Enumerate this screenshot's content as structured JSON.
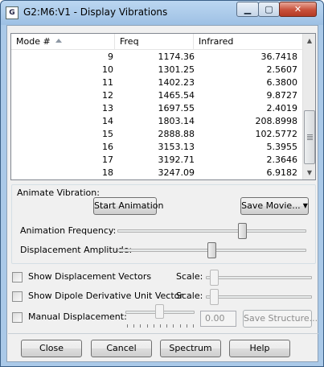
{
  "window": {
    "app_icon_text": "G",
    "title": "G2:M6:V1 - Display Vibrations",
    "min_glyph": "▁",
    "max_glyph": "▢",
    "close_glyph": "✕"
  },
  "table": {
    "headers": {
      "mode": "Mode #",
      "freq": "Freq",
      "ir": "Infrared"
    },
    "rows": [
      {
        "mode": "9",
        "freq": "1174.36",
        "ir": "36.7418"
      },
      {
        "mode": "10",
        "freq": "1301.25",
        "ir": "2.5607"
      },
      {
        "mode": "11",
        "freq": "1402.23",
        "ir": "6.3800"
      },
      {
        "mode": "12",
        "freq": "1465.54",
        "ir": "9.8727"
      },
      {
        "mode": "13",
        "freq": "1697.55",
        "ir": "2.4019"
      },
      {
        "mode": "14",
        "freq": "1803.14",
        "ir": "208.8998"
      },
      {
        "mode": "15",
        "freq": "2888.88",
        "ir": "102.5772"
      },
      {
        "mode": "16",
        "freq": "3153.13",
        "ir": "5.3955"
      },
      {
        "mode": "17",
        "freq": "3192.71",
        "ir": "2.3646"
      },
      {
        "mode": "18",
        "freq": "3247.09",
        "ir": "6.9182"
      }
    ],
    "scroll_up_glyph": "▲",
    "scroll_down_glyph": "▼"
  },
  "animate": {
    "group_label": "Animate Vibration:",
    "start_button": "Start Animation",
    "save_movie_button": "Save Movie...",
    "save_movie_caret": "▼",
    "frequency_label": "Animation Frequency:",
    "frequency_level": 0.67,
    "amplitude_label": "Displacement Amplitude:",
    "amplitude_level": 0.5
  },
  "options": {
    "show_vectors_label": "Show Displacement Vectors",
    "show_vectors_checked": false,
    "vectors_scale_label": "Scale:",
    "show_dipole_label": "Show Dipole Derivative Unit Vector",
    "show_dipole_checked": false,
    "dipole_scale_label": "Scale:",
    "manual_label": "Manual Displacement:",
    "manual_checked": false,
    "manual_value": "0.00",
    "save_structure_button": "Save Structure..."
  },
  "footer": {
    "close": "Close",
    "cancel": "Cancel",
    "spectrum": "Spectrum",
    "help": "Help"
  }
}
